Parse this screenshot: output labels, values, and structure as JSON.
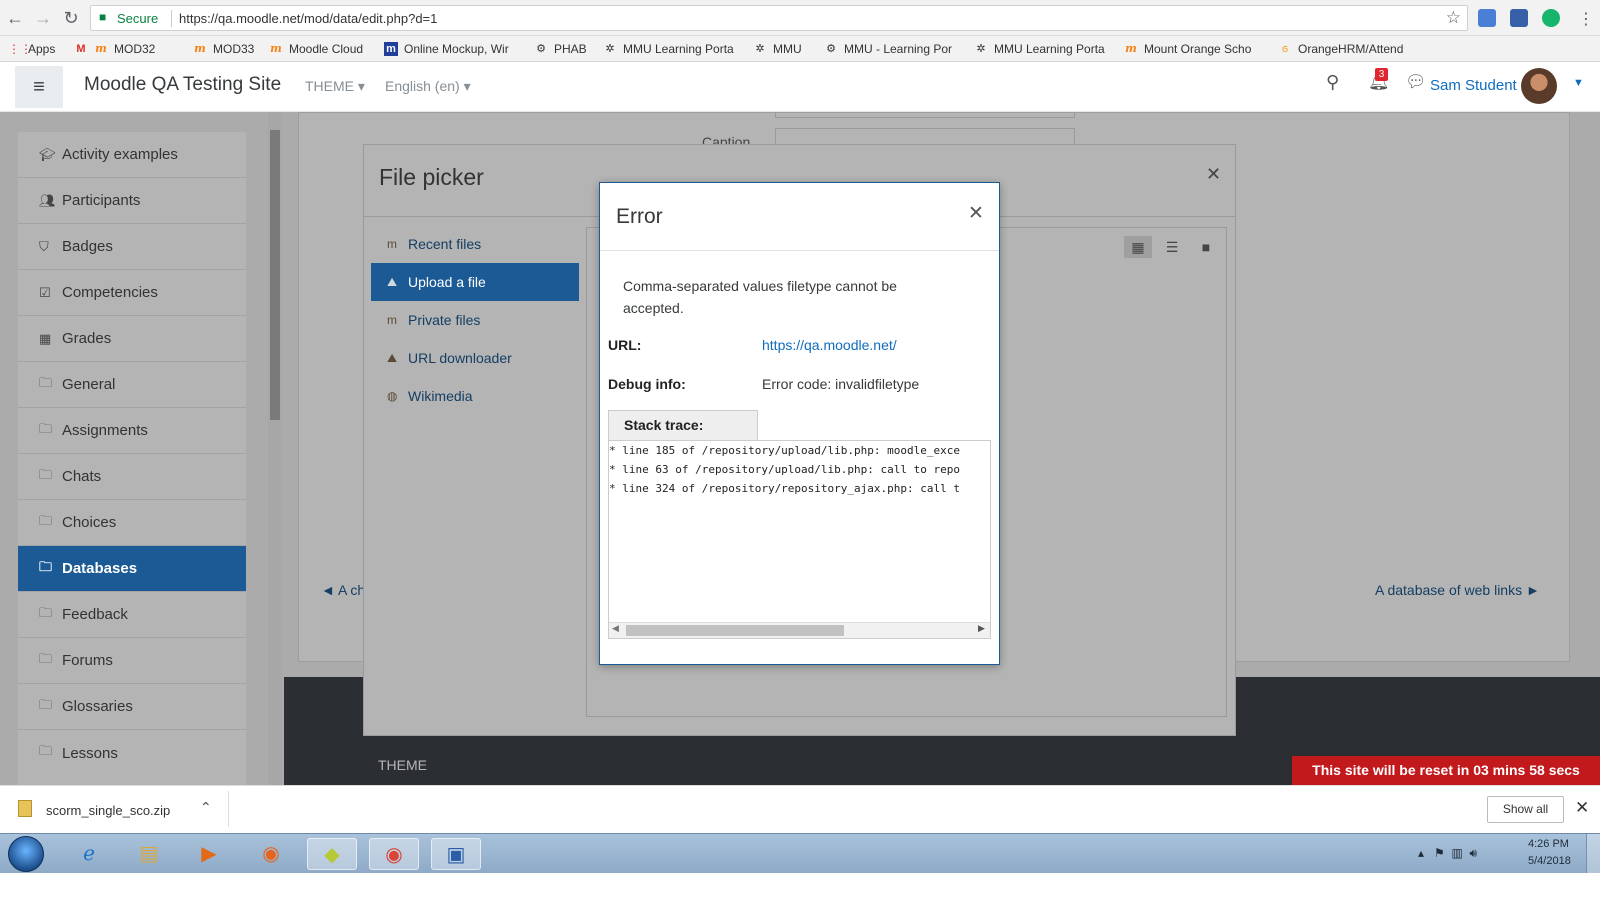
{
  "browser": {
    "secure_label": "Secure",
    "url": "https://qa.moodle.net/mod/data/edit.php?d=1"
  },
  "bookmarks": [
    {
      "label": "Apps"
    },
    {
      "label": "MOD32"
    },
    {
      "label": "MOD33"
    },
    {
      "label": "Moodle Cloud"
    },
    {
      "label": "Online Mockup, Wir"
    },
    {
      "label": "PHAB"
    },
    {
      "label": "MMU Learning Porta"
    },
    {
      "label": "MMU"
    },
    {
      "label": "MMU - Learning Por"
    },
    {
      "label": "MMU Learning Porta"
    },
    {
      "label": "Mount Orange Scho"
    },
    {
      "label": "OrangeHRM/Attend"
    }
  ],
  "header": {
    "site_title": "Moodle QA Testing Site",
    "theme_menu": "THEME",
    "language_menu": "English (en)",
    "notification_count": "3",
    "user_name": "Sam Student"
  },
  "nav": {
    "items": [
      {
        "label": "Activity examples"
      },
      {
        "label": "Participants"
      },
      {
        "label": "Badges"
      },
      {
        "label": "Competencies"
      },
      {
        "label": "Grades"
      },
      {
        "label": "General"
      },
      {
        "label": "Assignments"
      },
      {
        "label": "Chats"
      },
      {
        "label": "Choices"
      },
      {
        "label": "Databases"
      },
      {
        "label": "Feedback"
      },
      {
        "label": "Forums"
      },
      {
        "label": "Glossaries"
      },
      {
        "label": "Lessons"
      }
    ]
  },
  "page": {
    "caption_label": "Caption",
    "prev_link": "◄ A ch",
    "next_link": "A database of web links ►",
    "footer_theme": "THEME",
    "reset_banner": "This site will be reset in 03 mins 58 secs"
  },
  "file_picker": {
    "title": "File picker",
    "items": [
      {
        "label": "Recent files"
      },
      {
        "label": "Upload a file"
      },
      {
        "label": "Private files"
      },
      {
        "label": "URL downloader"
      },
      {
        "label": "Wikimedia"
      }
    ]
  },
  "error": {
    "title": "Error",
    "message": "Comma-separated values filetype cannot be accepted.",
    "url_label": "URL:",
    "url_value": "https://qa.moodle.net/",
    "debug_label": "Debug info:",
    "debug_value": "Error code: invalidfiletype",
    "stack_label": "Stack trace:",
    "stack_lines": [
      "* line 185 of /repository/upload/lib.php: moodle_exce",
      "* line 63 of /repository/upload/lib.php: call to repo",
      "* line 324 of /repository/repository_ajax.php: call t"
    ]
  },
  "download_bar": {
    "file_name": "scorm_single_sco.zip",
    "show_all": "Show all"
  },
  "taskbar": {
    "time": "4:26 PM",
    "date": "5/4/2018"
  }
}
